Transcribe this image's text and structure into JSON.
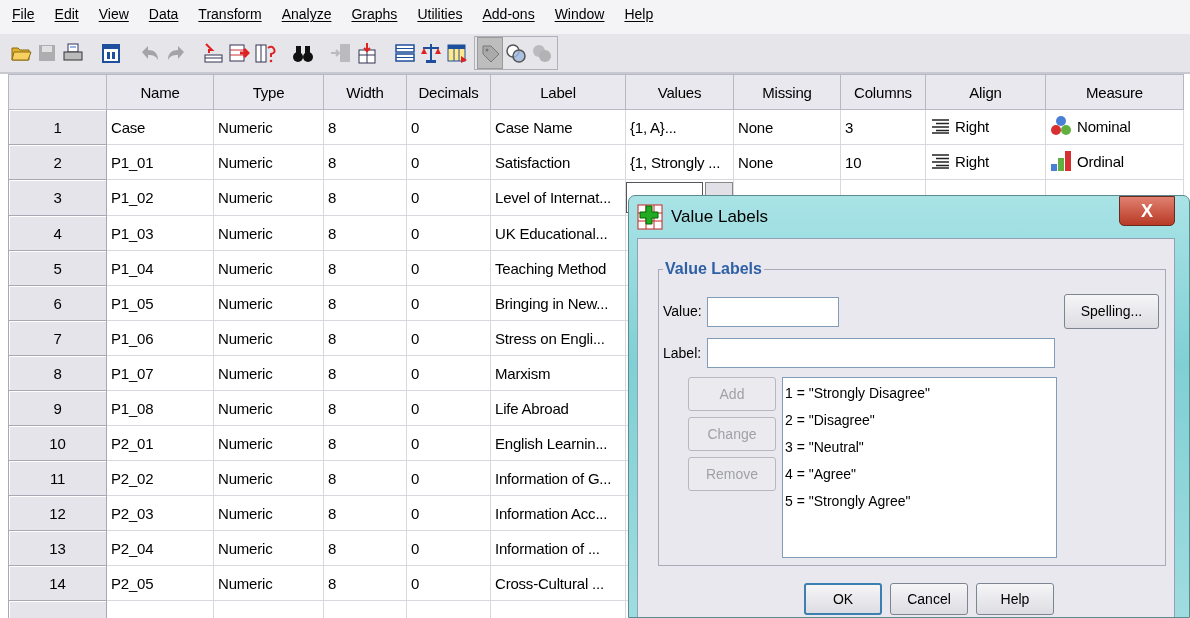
{
  "menu": [
    "File",
    "Edit",
    "View",
    "Data",
    "Transform",
    "Analyze",
    "Graphs",
    "Utilities",
    "Add-ons",
    "Window",
    "Help"
  ],
  "toolbar": [
    {
      "disabled": false,
      "pressed": false
    },
    {
      "disabled": true,
      "pressed": false
    },
    {
      "disabled": false,
      "pressed": false
    },
    {
      "disabled": false,
      "pressed": false
    },
    {
      "disabled": true,
      "pressed": false
    },
    {
      "disabled": true,
      "pressed": false
    },
    {
      "disabled": false,
      "pressed": false
    },
    {
      "disabled": false,
      "pressed": false
    },
    {
      "disabled": false,
      "pressed": false
    },
    {
      "disabled": false,
      "pressed": false
    },
    {
      "disabled": true,
      "pressed": false
    },
    {
      "disabled": false,
      "pressed": false
    },
    {
      "disabled": false,
      "pressed": false
    },
    {
      "disabled": false,
      "pressed": false
    },
    {
      "disabled": false,
      "pressed": false
    },
    {
      "disabled": false,
      "pressed": true
    },
    {
      "disabled": false,
      "pressed": false
    },
    {
      "disabled": true,
      "pressed": false
    }
  ],
  "grid": {
    "columns": [
      "Name",
      "Type",
      "Width",
      "Decimals",
      "Label",
      "Values",
      "Missing",
      "Columns",
      "Align",
      "Measure"
    ],
    "rows": [
      {
        "number": "1",
        "editing": false,
        "cells": [
          "Case",
          "Numeric",
          "8",
          "0",
          "Case Name",
          "{1, A}...",
          "None",
          "3",
          "Right",
          "Nominal"
        ],
        "kind": "nominal"
      },
      {
        "number": "2",
        "editing": false,
        "cells": [
          "P1_01",
          "Numeric",
          "8",
          "0",
          "Satisfaction",
          "{1, Strongly ...",
          "None",
          "10",
          "Right",
          "Ordinal"
        ],
        "kind": "ordinal"
      },
      {
        "number": "3",
        "editing": true,
        "cells": [
          "P1_02",
          "Numeric",
          "8",
          "0",
          "Level of Internat..."
        ]
      },
      {
        "number": "4",
        "editing": false,
        "cells": [
          "P1_03",
          "Numeric",
          "8",
          "0",
          "UK Educational..."
        ]
      },
      {
        "number": "5",
        "editing": false,
        "cells": [
          "P1_04",
          "Numeric",
          "8",
          "0",
          "Teaching Method"
        ]
      },
      {
        "number": "6",
        "editing": false,
        "cells": [
          "P1_05",
          "Numeric",
          "8",
          "0",
          "Bringing in New..."
        ]
      },
      {
        "number": "7",
        "editing": false,
        "cells": [
          "P1_06",
          "Numeric",
          "8",
          "0",
          "Stress on Engli..."
        ]
      },
      {
        "number": "8",
        "editing": false,
        "cells": [
          "P1_07",
          "Numeric",
          "8",
          "0",
          "Marxism"
        ]
      },
      {
        "number": "9",
        "editing": false,
        "cells": [
          "P1_08",
          "Numeric",
          "8",
          "0",
          "Life Abroad"
        ]
      },
      {
        "number": "10",
        "editing": false,
        "cells": [
          "P2_01",
          "Numeric",
          "8",
          "0",
          "English Learnin..."
        ]
      },
      {
        "number": "11",
        "editing": false,
        "cells": [
          "P2_02",
          "Numeric",
          "8",
          "0",
          "Information of G..."
        ]
      },
      {
        "number": "12",
        "editing": false,
        "cells": [
          "P2_03",
          "Numeric",
          "8",
          "0",
          "Information Acc..."
        ]
      },
      {
        "number": "13",
        "editing": false,
        "cells": [
          "P2_04",
          "Numeric",
          "8",
          "0",
          "Information of ..."
        ]
      },
      {
        "number": "14",
        "editing": false,
        "cells": [
          "P2_05",
          "Numeric",
          "8",
          "0",
          "Cross-Cultural ..."
        ]
      }
    ]
  },
  "dialog": {
    "title": "Value Labels",
    "close": "X",
    "group": "Value Labels",
    "value_label": "Value:",
    "label_label": "Label:",
    "spelling": "Spelling...",
    "side_buttons": [
      {
        "label": "Add",
        "disabled": true
      },
      {
        "label": "Change",
        "disabled": true
      },
      {
        "label": "Remove",
        "disabled": true
      }
    ],
    "list": [
      "1 = \"Strongly Disagree\"",
      "2 = \"Disagree\"",
      "3 = \"Neutral\"",
      "4 = \"Agree\"",
      "5 = \"Strongly Agree\""
    ],
    "footer": [
      {
        "label": "OK",
        "default": true
      },
      {
        "label": "Cancel",
        "default": false
      },
      {
        "label": "Help",
        "default": false
      }
    ]
  }
}
